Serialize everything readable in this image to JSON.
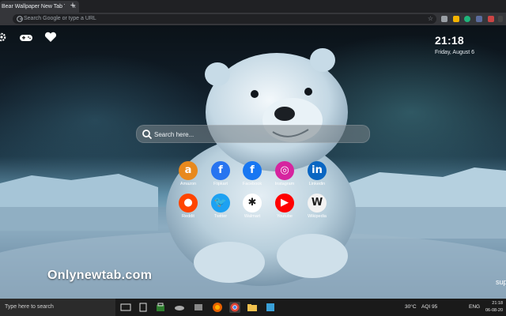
{
  "browser": {
    "tab_title": "Bear Wallpaper New Tab Th",
    "tab_close": "×",
    "new_tab": "+",
    "omnibox_placeholder": "Search Google or type a URL",
    "bookmark_star": "☆"
  },
  "page": {
    "clock": "21:18",
    "date": "Friday, August 6",
    "search_placeholder": "Search here...",
    "shortcuts": [
      {
        "label": "Amazon",
        "glyph": "a",
        "color": "#e8891d"
      },
      {
        "label": "Flipkart",
        "glyph": "f",
        "color": "#2874f0"
      },
      {
        "label": "Facebook",
        "glyph": "f",
        "color": "#1877f2"
      },
      {
        "label": "Instagram",
        "glyph": "◎",
        "color": "#d6249f"
      },
      {
        "label": "Linkedin",
        "glyph": "in",
        "color": "#0a66c2"
      },
      {
        "label": "Reddit",
        "glyph": "●",
        "color": "#ff4500"
      },
      {
        "label": "Twitter",
        "glyph": "🐦",
        "color": "#1da1f2"
      },
      {
        "label": "Walmart",
        "glyph": "✱",
        "color": "#ffffff"
      },
      {
        "label": "Youtube",
        "glyph": "▶",
        "color": "#ff0000"
      },
      {
        "label": "Wikipedia",
        "glyph": "W",
        "color": "#f2f2f2"
      }
    ],
    "brand": "Onlynewtab.com",
    "corner_text": "sup"
  },
  "taskbar": {
    "search_text": "Type here to search",
    "weather": "30°C",
    "aqi": "AQI 95",
    "lang": "ENG",
    "time": "21:18",
    "date": "06-08-20"
  },
  "icons": {
    "settings": "gear-icon",
    "games": "gamepad-icon",
    "favorites": "heart-icon",
    "search": "search-icon"
  }
}
